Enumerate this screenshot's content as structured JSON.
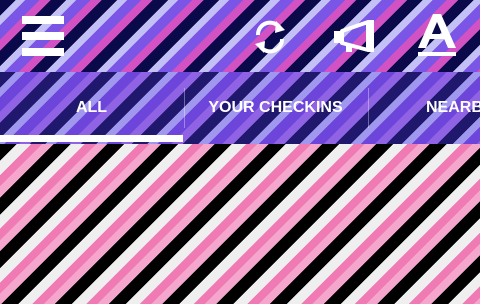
{
  "toolbar": {
    "icons": [
      "menu-icon",
      "refresh-icon",
      "megaphone-icon",
      "font-icon"
    ]
  },
  "tabs": [
    {
      "label": "ALL",
      "selected": true
    },
    {
      "label": "YOUR CHECKINS",
      "selected": false
    },
    {
      "label": "NEARB",
      "selected": false
    }
  ],
  "colors": {
    "appbar_stripes": [
      "#0a0a4a",
      "#c2c0f4",
      "#7a55e6",
      "#d252c4"
    ],
    "tabbar_stripes": [
      "#20186c",
      "#9f98ee",
      "#6e45da",
      "#8f63e4"
    ],
    "content_stripes": [
      "#000000",
      "#efefef",
      "#f07ab4",
      "#f5a6cd"
    ],
    "text": "#ffffff"
  }
}
